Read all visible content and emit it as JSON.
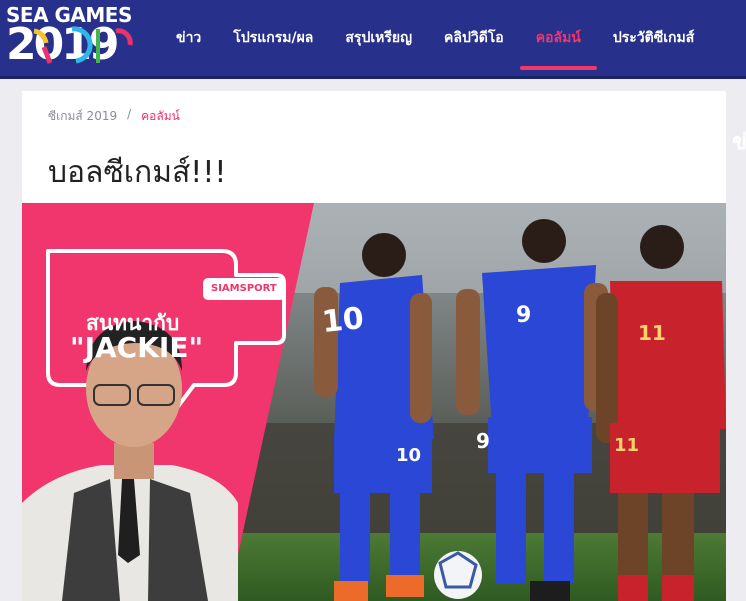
{
  "logo": {
    "line1": "SEA GAMES",
    "line2_digits": [
      "2",
      "0",
      "1",
      "9"
    ],
    "line2_colors": [
      "#ffffff",
      "#ffffff",
      "#ffffff",
      "#ffffff"
    ]
  },
  "nav": {
    "items": [
      {
        "label": "ข่าว",
        "active": false
      },
      {
        "label": "โปรแกรม/ผล",
        "active": false
      },
      {
        "label": "สรุปเหรียญ",
        "active": false
      },
      {
        "label": "คลิปวิดีโอ",
        "active": false
      },
      {
        "label": "คอลัมน์",
        "active": true
      },
      {
        "label": "ประวัติซีเกมส์",
        "active": false
      }
    ]
  },
  "breadcrumb": {
    "home": "ซีเกมส์ 2019",
    "separator": "/",
    "current": "คอลัมน์"
  },
  "article": {
    "title": "บอลซีเกมส์!!!",
    "peek_char": "ข่"
  },
  "hero": {
    "tag": "SIAMSPORT",
    "line1": "สนทนากับ",
    "line2": "\"JACKIE\"",
    "jersey_numbers": [
      "10",
      "9",
      "9",
      "11",
      "11",
      "10"
    ]
  },
  "colors": {
    "header_bg": "#27318b",
    "accent": "#f0366c",
    "page_bg": "#ececf1",
    "thai_blue": "#2b47d6",
    "indo_red": "#c8232c"
  }
}
